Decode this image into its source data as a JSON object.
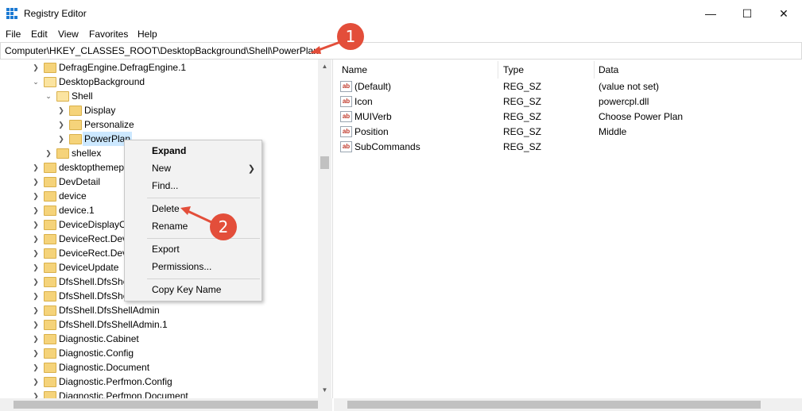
{
  "window": {
    "title": "Registry Editor",
    "icon": "regedit-icon"
  },
  "menu": [
    "File",
    "Edit",
    "View",
    "Favorites",
    "Help"
  ],
  "address": {
    "value": "Computer\\HKEY_CLASSES_ROOT\\DesktopBackground\\Shell\\PowerPlan"
  },
  "tree": [
    "DefragEngine.DefragEngine.1",
    "DesktopBackground",
    "Shell",
    "Display",
    "Personalize",
    "PowerPlan",
    "shellex",
    "desktopthemep",
    "DevDetail",
    "device",
    "device.1",
    "DeviceDisplayO",
    "DeviceRect.Dev",
    "DeviceRect.Dev",
    "DeviceUpdate",
    "DfsShell.DfsShe",
    "DfsShell.DfsShe",
    "DfsShell.DfsShellAdmin",
    "DfsShell.DfsShellAdmin.1",
    "Diagnostic.Cabinet",
    "Diagnostic.Config",
    "Diagnostic.Document",
    "Diagnostic.Perfmon.Config",
    "Diagnostic.Perfmon.Document"
  ],
  "columns": {
    "name": "Name",
    "type": "Type",
    "data": "Data"
  },
  "values": [
    {
      "name": "(Default)",
      "type": "REG_SZ",
      "data": "(value not set)"
    },
    {
      "name": "Icon",
      "type": "REG_SZ",
      "data": "powercpl.dll"
    },
    {
      "name": "MUIVerb",
      "type": "REG_SZ",
      "data": "Choose Power Plan"
    },
    {
      "name": "Position",
      "type": "REG_SZ",
      "data": "Middle"
    },
    {
      "name": "SubCommands",
      "type": "REG_SZ",
      "data": ""
    }
  ],
  "context_menu": {
    "expand": "Expand",
    "new": "New",
    "find": "Find...",
    "delete": "Delete",
    "rename": "Rename",
    "export": "Export",
    "permissions": "Permissions...",
    "copy_key_name": "Copy Key Name"
  },
  "annotations": {
    "step1": "1",
    "step2": "2",
    "color": "#e34e3a"
  }
}
